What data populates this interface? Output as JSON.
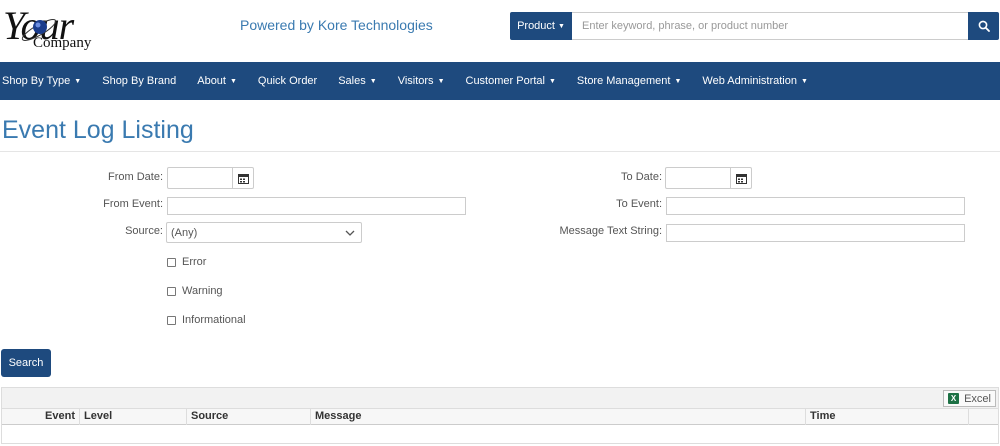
{
  "header": {
    "logo_word": "Your",
    "logo_sub": "Company",
    "tagline": "Powered by Kore Technologies",
    "search": {
      "scope_label": "Product",
      "placeholder": "Enter keyword, phrase, or product number"
    }
  },
  "nav": {
    "items": [
      {
        "label": "Shop By Type",
        "dropdown": true
      },
      {
        "label": "Shop By Brand",
        "dropdown": false
      },
      {
        "label": "About",
        "dropdown": true
      },
      {
        "label": "Quick Order",
        "dropdown": false
      },
      {
        "label": "Sales",
        "dropdown": true
      },
      {
        "label": "Visitors",
        "dropdown": true
      },
      {
        "label": "Customer Portal",
        "dropdown": true
      },
      {
        "label": "Store Management",
        "dropdown": true
      },
      {
        "label": "Web Administration",
        "dropdown": true
      }
    ]
  },
  "page": {
    "title": "Event Log Listing"
  },
  "form": {
    "from_date_label": "From Date:",
    "to_date_label": "To Date:",
    "from_event_label": "From Event:",
    "to_event_label": "To Event:",
    "source_label": "Source:",
    "source_value": "(Any)",
    "message_label": "Message Text String:",
    "checkboxes": [
      {
        "label": "Error",
        "checked": false
      },
      {
        "label": "Warning",
        "checked": false
      },
      {
        "label": "Informational",
        "checked": false
      }
    ],
    "search_button": "Search"
  },
  "grid": {
    "excel_label": "Excel",
    "columns": [
      "Event",
      "Level",
      "Source",
      "Message",
      "Time"
    ]
  },
  "colors": {
    "brand": "#1e4a7e",
    "title": "#3a7ab0"
  }
}
